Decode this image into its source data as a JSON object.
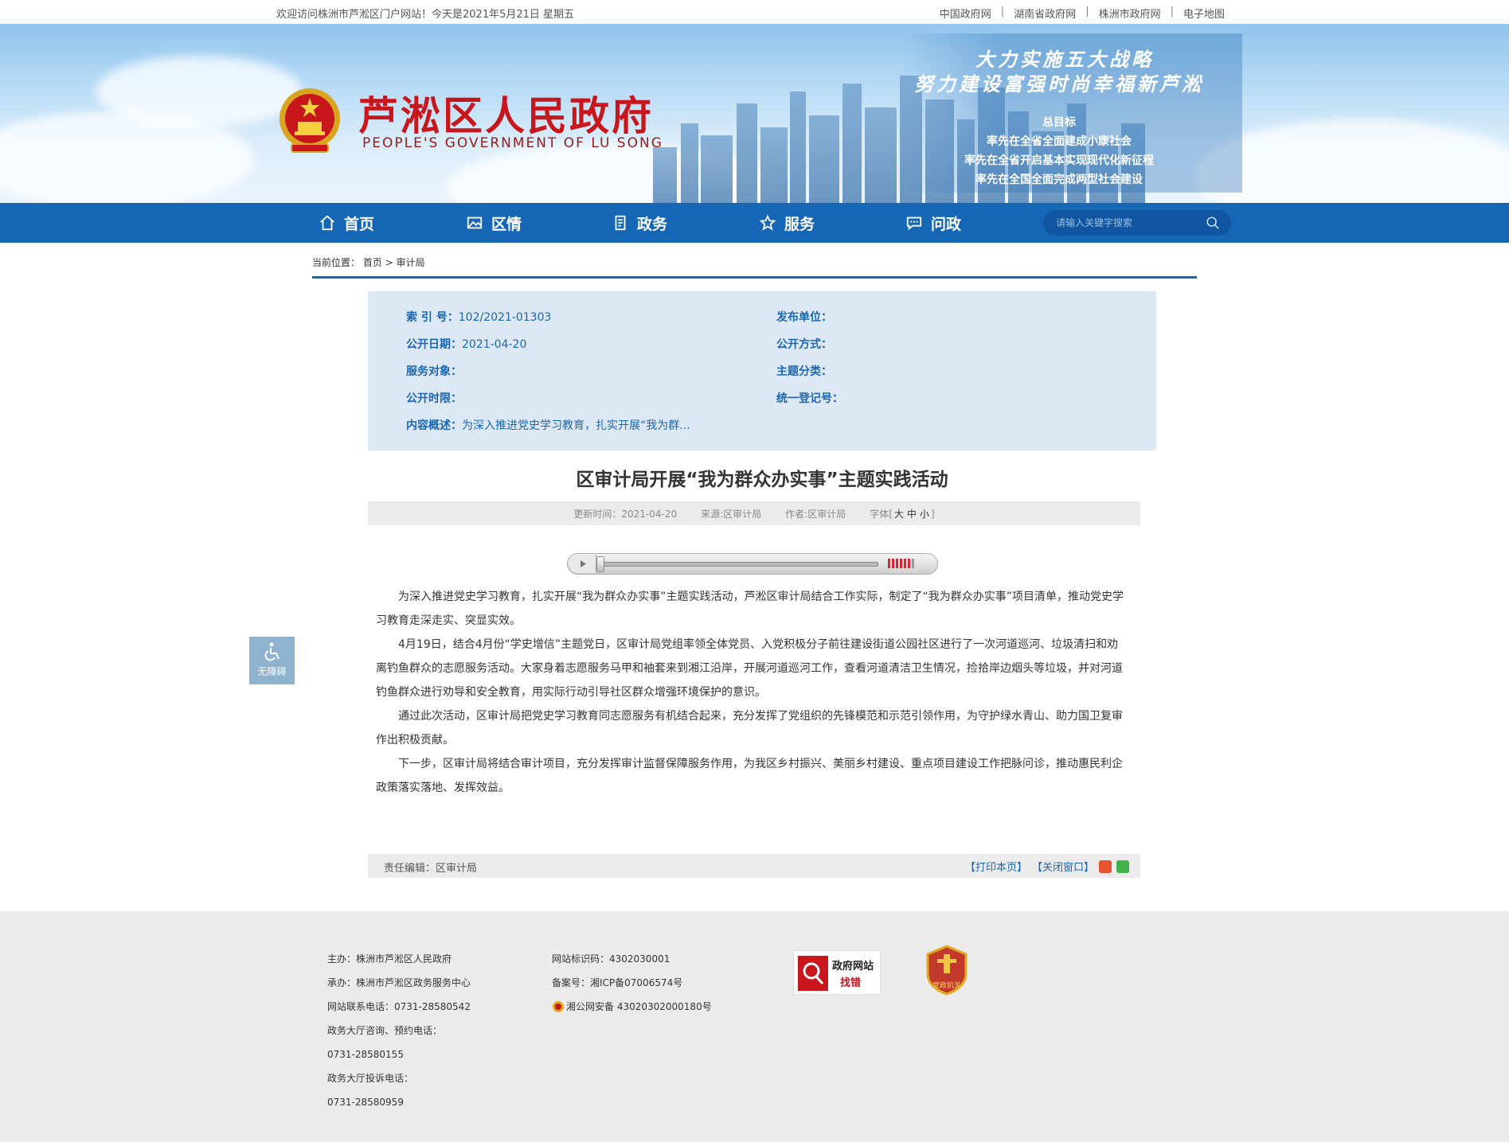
{
  "topbar": {
    "welcome": "欢迎访问株洲市芦淞区门户网站！今天是2021年5月21日 星期五",
    "links": [
      "中国政府网",
      "湖南省政府网",
      "株洲市政府网",
      "电子地图"
    ],
    "separator": "|"
  },
  "header": {
    "title": "芦淞区人民政府",
    "subtitle": "PEOPLE'S GOVERNMENT OF  LU SONG",
    "slogan_line1": "大力实施五大战略",
    "slogan_line2": "努力建设富强时尚幸福新芦淞",
    "goals_title": "总目标",
    "goals": [
      "率先在全省全面建成小康社会",
      "率先在全省开启基本实现现代化新征程",
      "率先在全国全面完成两型社会建设"
    ]
  },
  "nav": {
    "items": [
      {
        "label": "首页",
        "icon": "home-icon"
      },
      {
        "label": "区情",
        "icon": "picture-icon"
      },
      {
        "label": "政务",
        "icon": "document-icon"
      },
      {
        "label": "服务",
        "icon": "star-icon"
      },
      {
        "label": "问政",
        "icon": "chat-icon"
      }
    ],
    "search_placeholder": "请输入关键字搜索"
  },
  "breadcrumb": {
    "prefix": "当前位置：",
    "home": "首页",
    "sep": ">",
    "current": "审计局"
  },
  "info": {
    "index_label": "索 引 号：",
    "index_value": "102/2021-01303",
    "date_label": "公开日期：",
    "date_value": "2021-04-20",
    "target_label": "服务对象：",
    "time_limit_label": "公开时限：",
    "summary_label": "内容概述：",
    "summary_value": "为深入推进党史学习教育，扎实开展“我为群...",
    "publisher_label": "发布单位：",
    "method_label": "公开方式：",
    "topic_label": "主题分类：",
    "reg_label": "统一登记号："
  },
  "article": {
    "title": "区审计局开展“我为群众办实事”主题实践活动",
    "updated": "更新时间：2021-04-20",
    "source": "来源:区审计局",
    "author": "作者:区审计局",
    "font_label": "字体[",
    "font_large": "大",
    "font_medium": "中",
    "font_small": "小",
    "font_end": "]",
    "paragraphs": [
      "为深入推进党史学习教育，扎实开展“我为群众办实事”主题实践活动，芦淞区审计局结合工作实际，制定了“我为群众办实事”项目清单，推动党史学习教育走深走实、突显实效。",
      "4月19日，结合4月份“学史增信”主题党日，区审计局党组率领全体党员、入党积极分子前往建设街道公园社区进行了一次河道巡河、垃圾清扫和劝离钓鱼群众的志愿服务活动。大家身着志愿服务马甲和袖套来到湘江沿岸，开展河道巡河工作，查看河道清洁卫生情况，捡拾岸边烟头等垃圾，并对河道钓鱼群众进行劝导和安全教育，用实际行动引导社区群众增强环境保护的意识。",
      "通过此次活动，区审计局把党史学习教育同志愿服务有机结合起来，充分发挥了党组织的先锋模范和示范引领作用，为守护绿水青山、助力国卫复审作出积极贡献。",
      "下一步，区审计局将结合审计项目，充分发挥审计监督保障服务作用，为我区乡村振兴、美丽乡村建设、重点项目建设工作把脉问诊，推动惠民利企政策落实落地、发挥效益。"
    ],
    "editor": "责任编辑：区审计局",
    "print": "【打印本页】",
    "close": "【关闭窗口】"
  },
  "accessibility": {
    "label": "无障碍"
  },
  "footer": {
    "col1": [
      "主办：株洲市芦淞区人民政府",
      "承办：株洲市芦淞区政务服务中心",
      "网站联系电话：0731-28580542",
      "政务大厅咨询、预约电话：",
      "0731-28580155",
      "政务大厅投诉电话：",
      "0731-28580959"
    ],
    "col2": [
      "网站标识码：4302030001",
      " 备案号：湘ICP备07006574号",
      "湘公网安备 43020302000180号"
    ],
    "badge1_line1": "政府网站",
    "badge1_line2": "找错",
    "badge2": "党政机关"
  },
  "colors": {
    "nav_bg": "#1566b4",
    "title_red": "#c8161d",
    "info_bg": "#dce9f4",
    "footer_bg": "#ebebeb"
  }
}
